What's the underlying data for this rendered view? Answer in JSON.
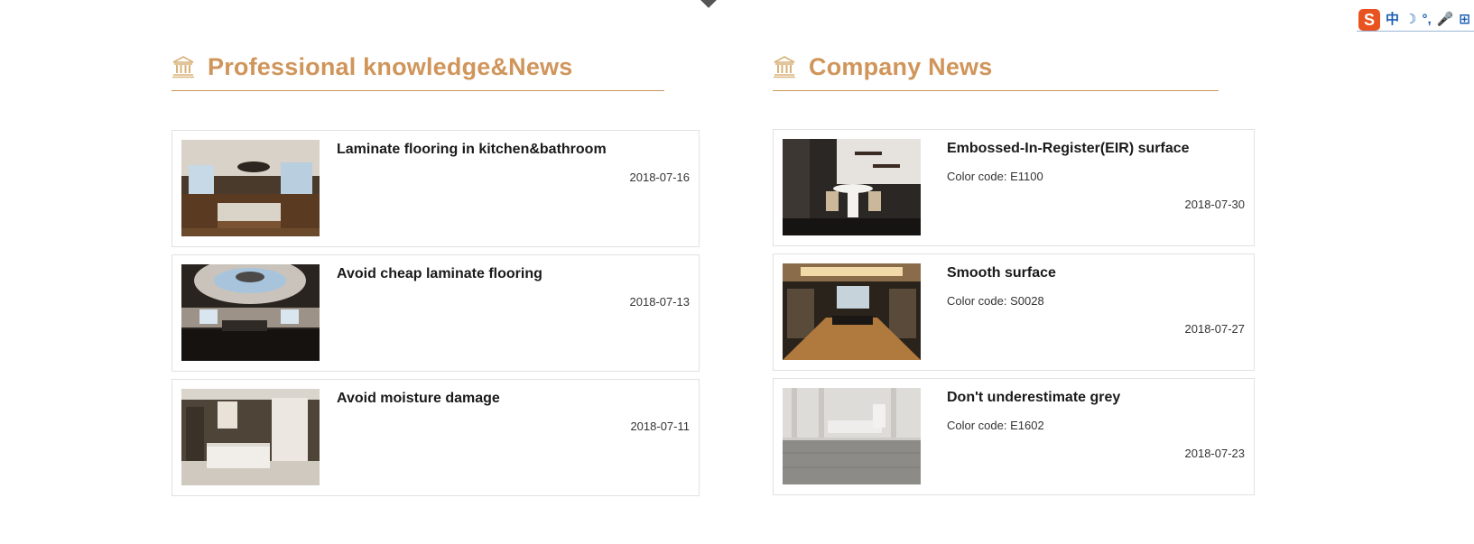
{
  "ime": {
    "logo": "S",
    "items": [
      "中",
      "☽",
      "°,",
      "🎤",
      "⊞"
    ]
  },
  "left_section": {
    "title": "Professional knowledge&News",
    "items": [
      {
        "title": "Laminate flooring in kitchen&bathroom",
        "date": "2018-07-16",
        "image": "kitchen-photo"
      },
      {
        "title": "Avoid cheap laminate flooring",
        "date": "2018-07-13",
        "image": "dome-room-photo"
      },
      {
        "title": "Avoid moisture damage",
        "date": "2018-07-11",
        "image": "bathroom-photo"
      }
    ]
  },
  "right_section": {
    "title": "Company News",
    "items": [
      {
        "title": "Embossed-In-Register(EIR) surface",
        "code": "Color code: E1100",
        "date": "2018-07-30",
        "image": "dining-room-photo"
      },
      {
        "title": "Smooth surface",
        "code": "Color code: S0028",
        "date": "2018-07-27",
        "image": "living-room-photo"
      },
      {
        "title": "Don't underestimate grey",
        "code": "Color code: E1602",
        "date": "2018-07-23",
        "image": "grey-floor-photo"
      }
    ]
  },
  "colors": {
    "accent": "#d0955a",
    "border": "#e1e1e1",
    "ime_accent": "#e8531f"
  }
}
